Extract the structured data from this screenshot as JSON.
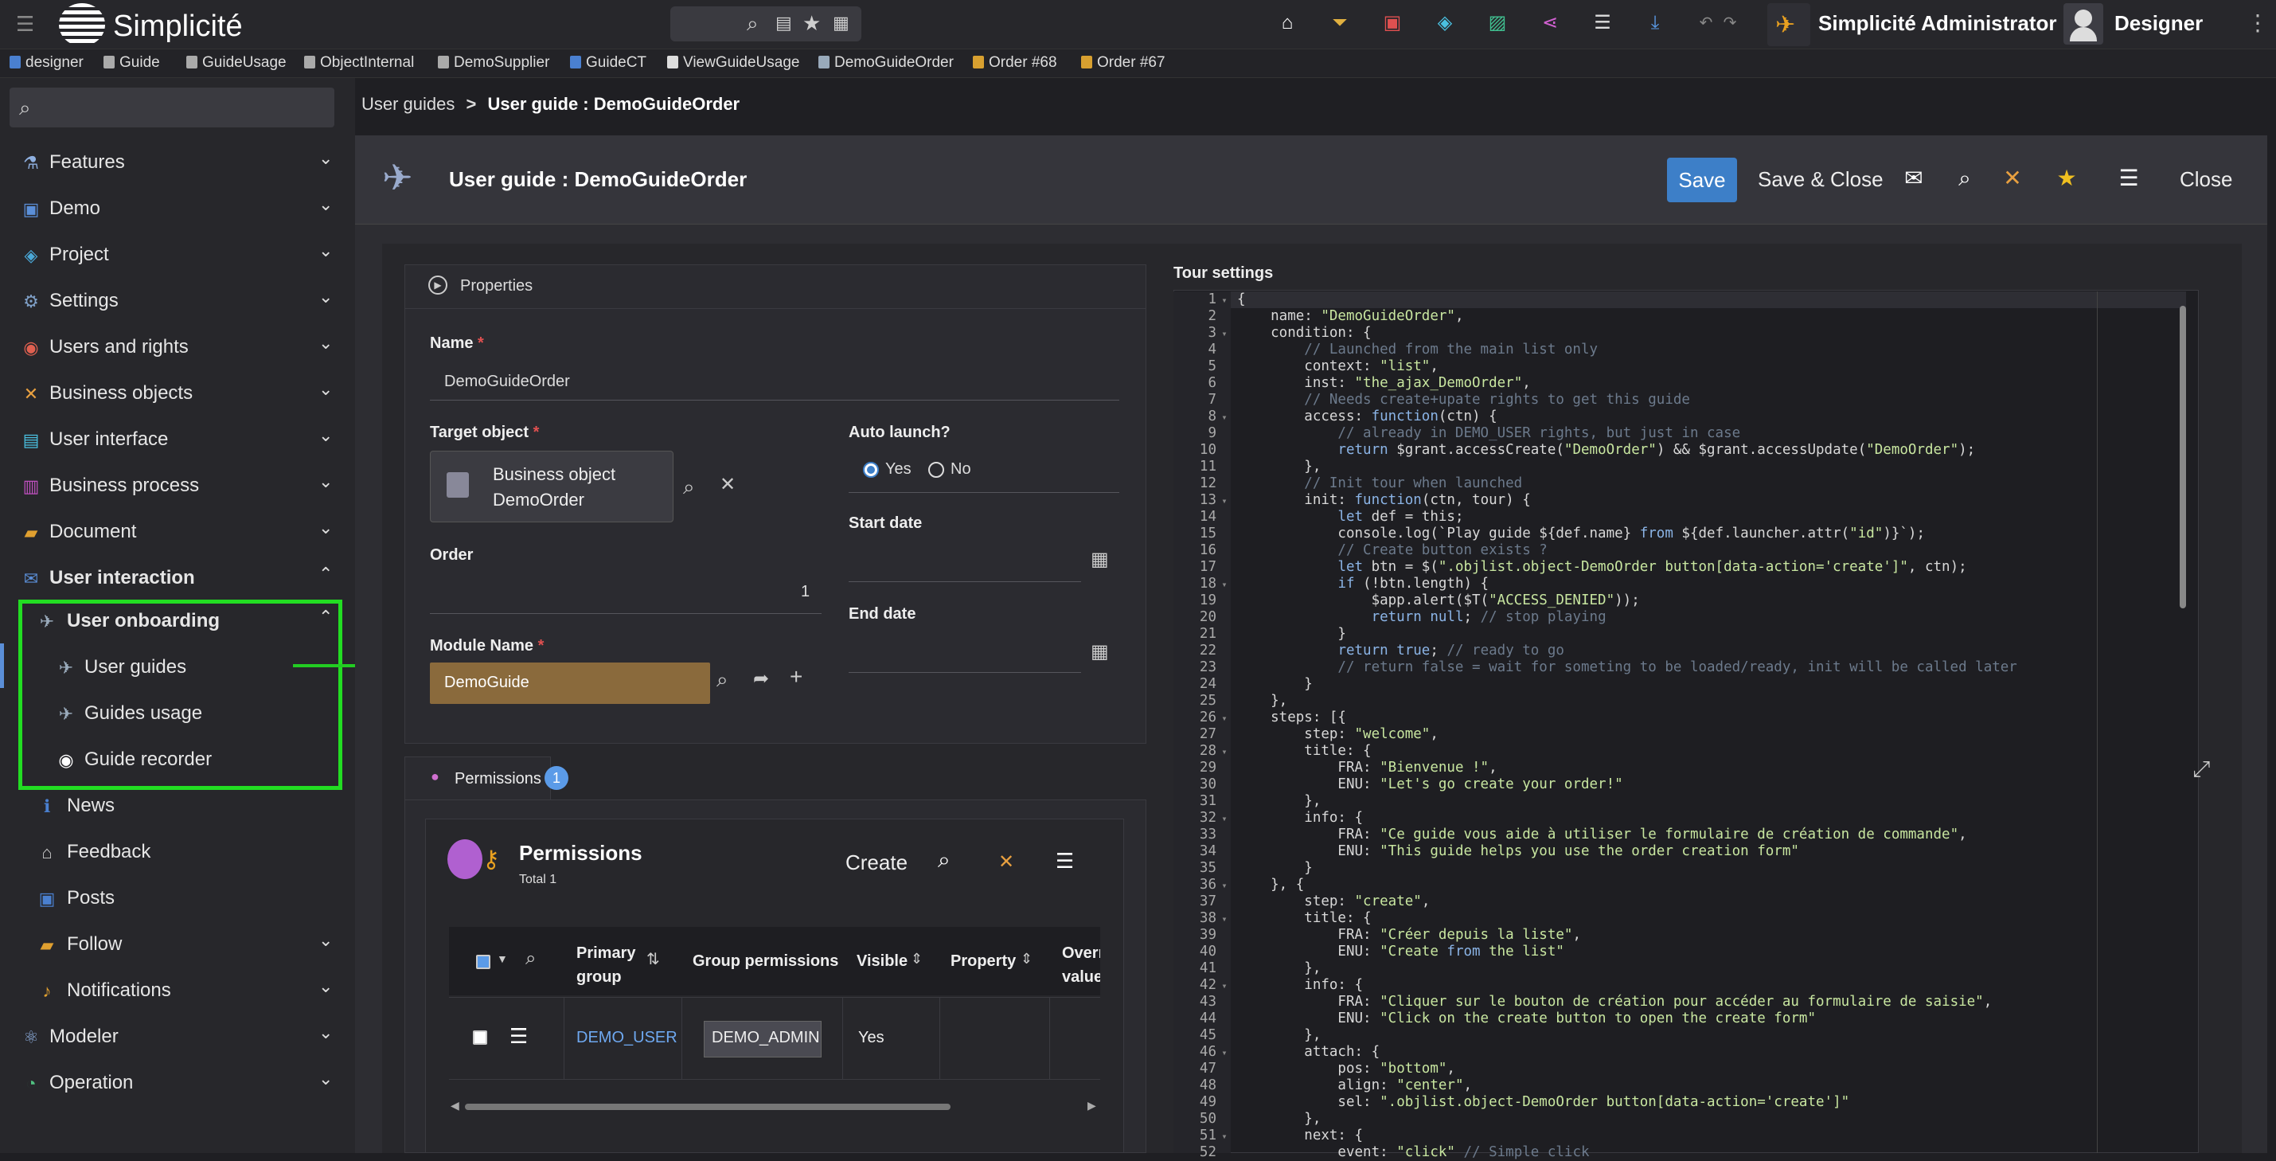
{
  "app": {
    "name": "Simplicité",
    "search_icons": [
      "search-icon",
      "table-icon",
      "star-icon",
      "grid-icon"
    ],
    "user_label": "Simplicité Administrator",
    "designer_label": "Designer"
  },
  "quick_tabs": [
    {
      "label": "designer",
      "color": "#4a80d0"
    },
    {
      "label": "Guide",
      "color": "#aaaaaa"
    },
    {
      "label": "GuideUsage",
      "color": "#aaaaaa"
    },
    {
      "label": "ObjectInternal",
      "color": "#aaaaaa"
    },
    {
      "label": "DemoSupplier",
      "color": "#aaaaaa"
    },
    {
      "label": "GuideCT",
      "color": "#4a80d0"
    },
    {
      "label": "ViewGuideUsage",
      "color": "#dddddd"
    },
    {
      "label": "DemoGuideOrder",
      "color": "#9ab"
    },
    {
      "label": "Order #68",
      "color": "#d8a030"
    },
    {
      "label": "Order #67",
      "color": "#d8a030"
    }
  ],
  "sidebar": {
    "items": [
      {
        "label": "Features",
        "icon": "flask-icon",
        "color": "#8fb0e0",
        "chevron": "down"
      },
      {
        "label": "Demo",
        "icon": "demo-icon",
        "color": "#5b8fd8",
        "chevron": "down"
      },
      {
        "label": "Project",
        "icon": "project-icon",
        "color": "#4aa8d8",
        "chevron": "down"
      },
      {
        "label": "Settings",
        "icon": "gear-icon",
        "color": "#7fa0c8",
        "chevron": "down"
      },
      {
        "label": "Users and rights",
        "icon": "users-icon",
        "color": "#e06050",
        "chevron": "down"
      },
      {
        "label": "Business objects",
        "icon": "objects-icon",
        "color": "#e8a040",
        "chevron": "down"
      },
      {
        "label": "User interface",
        "icon": "ui-icon",
        "color": "#4ac0e0",
        "chevron": "down"
      },
      {
        "label": "Business process",
        "icon": "process-icon",
        "color": "#c050c0",
        "chevron": "down"
      },
      {
        "label": "Document",
        "icon": "folder-icon",
        "color": "#e0a030",
        "chevron": "down"
      },
      {
        "label": "User interaction",
        "icon": "chat-icon",
        "color": "#5b8fd8",
        "chevron": "up"
      }
    ],
    "sub_group": {
      "label": "User onboarding",
      "chevron": "up"
    },
    "sub_items": [
      {
        "label": "User guides",
        "icon": "plane-icon"
      },
      {
        "label": "Guides usage",
        "icon": "plane-icon"
      },
      {
        "label": "Guide recorder",
        "icon": "record-icon"
      }
    ],
    "more_items": [
      {
        "label": "News",
        "icon": "info-icon",
        "color": "#4a80d0",
        "chevron": ""
      },
      {
        "label": "Feedback",
        "icon": "feedback-icon",
        "color": "#ccc",
        "chevron": ""
      },
      {
        "label": "Posts",
        "icon": "post-icon",
        "color": "#4a80d0",
        "chevron": ""
      },
      {
        "label": "Follow",
        "icon": "follow-icon",
        "color": "#e0a030",
        "chevron": "down"
      },
      {
        "label": "Notifications",
        "icon": "bell-icon",
        "color": "#e0a030",
        "chevron": "down"
      }
    ],
    "bottom_items": [
      {
        "label": "Modeler",
        "icon": "modeler-icon",
        "color": "#8fb0e0",
        "chevron": "down"
      },
      {
        "label": "Operation",
        "icon": "operation-icon",
        "color": "#50c080",
        "chevron": "down"
      }
    ]
  },
  "breadcrumb": {
    "parent": "User guides",
    "current": "User guide : DemoGuideOrder"
  },
  "header": {
    "title": "User guide : DemoGuideOrder",
    "save": "Save",
    "save_close": "Save & Close",
    "close": "Close"
  },
  "properties": {
    "section_label": "Properties",
    "name_label": "Name",
    "name_value": "DemoGuideOrder",
    "target_label": "Target object",
    "target_line1": "Business object",
    "target_line2": "DemoOrder",
    "auto_label": "Auto launch?",
    "yes": "Yes",
    "no": "No",
    "auto_value": "Yes",
    "start_label": "Start date",
    "order_label": "Order",
    "order_value": "1",
    "end_label": "End date",
    "module_label": "Module Name",
    "module_value": "DemoGuide"
  },
  "permissions": {
    "tab_label": "Permissions",
    "count": "1",
    "title": "Permissions",
    "total": "Total 1",
    "create": "Create",
    "columns": [
      "Primary group",
      "Group permissions",
      "Visible",
      "Property",
      "Overr value"
    ],
    "rows": [
      {
        "primary_group": "DEMO_USER",
        "group_permissions": "DEMO_ADMIN",
        "visible": "Yes",
        "property": "",
        "override": ""
      }
    ]
  },
  "tour": {
    "label": "Tour settings",
    "lines": [
      {
        "n": "1",
        "fold": "▾",
        "t": "{"
      },
      {
        "n": "2",
        "fold": "",
        "t": "    name: \"DemoGuideOrder\","
      },
      {
        "n": "3",
        "fold": "▾",
        "t": "    condition: {"
      },
      {
        "n": "4",
        "fold": "",
        "t": "        // Launched from the main list only"
      },
      {
        "n": "5",
        "fold": "",
        "t": "        context: \"list\","
      },
      {
        "n": "6",
        "fold": "",
        "t": "        inst: \"the_ajax_DemoOrder\","
      },
      {
        "n": "7",
        "fold": "",
        "t": "        // Needs create+upate rights to get this guide"
      },
      {
        "n": "8",
        "fold": "▾",
        "t": "        access: function(ctn) {"
      },
      {
        "n": "9",
        "fold": "",
        "t": "            // already in DEMO_USER rights, but just in case"
      },
      {
        "n": "10",
        "fold": "",
        "t": "            return $grant.accessCreate(\"DemoOrder\") && $grant.accessUpdate(\"DemoOrder\");"
      },
      {
        "n": "11",
        "fold": "",
        "t": "        },"
      },
      {
        "n": "12",
        "fold": "",
        "t": "        // Init tour when launched"
      },
      {
        "n": "13",
        "fold": "▾",
        "t": "        init: function(ctn, tour) {"
      },
      {
        "n": "14",
        "fold": "",
        "t": "            let def = this;"
      },
      {
        "n": "15",
        "fold": "",
        "t": "            console.log(`Play guide ${def.name} from ${def.launcher.attr(\"id\")}`);"
      },
      {
        "n": "16",
        "fold": "",
        "t": "            // Create button exists ?"
      },
      {
        "n": "17",
        "fold": "",
        "t": "            let btn = $(\".objlist.object-DemoOrder button[data-action='create']\", ctn);"
      },
      {
        "n": "18",
        "fold": "▾",
        "t": "            if (!btn.length) {"
      },
      {
        "n": "19",
        "fold": "",
        "t": "                $app.alert($T(\"ACCESS_DENIED\"));"
      },
      {
        "n": "20",
        "fold": "",
        "t": "                return null; // stop playing"
      },
      {
        "n": "21",
        "fold": "",
        "t": "            }"
      },
      {
        "n": "22",
        "fold": "",
        "t": "            return true; // ready to go"
      },
      {
        "n": "23",
        "fold": "",
        "t": "            // return false = wait for someting to be loaded/ready, init will be called later"
      },
      {
        "n": "24",
        "fold": "",
        "t": "        }"
      },
      {
        "n": "25",
        "fold": "",
        "t": "    },"
      },
      {
        "n": "26",
        "fold": "▾",
        "t": "    steps: [{"
      },
      {
        "n": "27",
        "fold": "",
        "t": "        step: \"welcome\","
      },
      {
        "n": "28",
        "fold": "▾",
        "t": "        title: {"
      },
      {
        "n": "29",
        "fold": "",
        "t": "            FRA: \"Bienvenue !\","
      },
      {
        "n": "30",
        "fold": "",
        "t": "            ENU: \"Let's go create your order!\""
      },
      {
        "n": "31",
        "fold": "",
        "t": "        },"
      },
      {
        "n": "32",
        "fold": "▾",
        "t": "        info: {"
      },
      {
        "n": "33",
        "fold": "",
        "t": "            FRA: \"Ce guide vous aide à utiliser le formulaire de création de commande\","
      },
      {
        "n": "34",
        "fold": "",
        "t": "            ENU: \"This guide helps you use the order creation form\""
      },
      {
        "n": "35",
        "fold": "",
        "t": "        }"
      },
      {
        "n": "36",
        "fold": "▾",
        "t": "    }, {"
      },
      {
        "n": "37",
        "fold": "",
        "t": "        step: \"create\","
      },
      {
        "n": "38",
        "fold": "▾",
        "t": "        title: {"
      },
      {
        "n": "39",
        "fold": "",
        "t": "            FRA: \"Créer depuis la liste\","
      },
      {
        "n": "40",
        "fold": "",
        "t": "            ENU: \"Create from the list\""
      },
      {
        "n": "41",
        "fold": "",
        "t": "        },"
      },
      {
        "n": "42",
        "fold": "▾",
        "t": "        info: {"
      },
      {
        "n": "43",
        "fold": "",
        "t": "            FRA: \"Cliquer sur le bouton de création pour accéder au formulaire de saisie\","
      },
      {
        "n": "44",
        "fold": "",
        "t": "            ENU: \"Click on the create button to open the create form\""
      },
      {
        "n": "45",
        "fold": "",
        "t": "        },"
      },
      {
        "n": "46",
        "fold": "▾",
        "t": "        attach: {"
      },
      {
        "n": "47",
        "fold": "",
        "t": "            pos: \"bottom\","
      },
      {
        "n": "48",
        "fold": "",
        "t": "            align: \"center\","
      },
      {
        "n": "49",
        "fold": "",
        "t": "            sel: \".objlist.object-DemoOrder button[data-action='create']\""
      },
      {
        "n": "50",
        "fold": "",
        "t": "        },"
      },
      {
        "n": "51",
        "fold": "▾",
        "t": "        next: {"
      },
      {
        "n": "52",
        "fold": "",
        "t": "            event: \"click\" // Simple click"
      }
    ]
  }
}
